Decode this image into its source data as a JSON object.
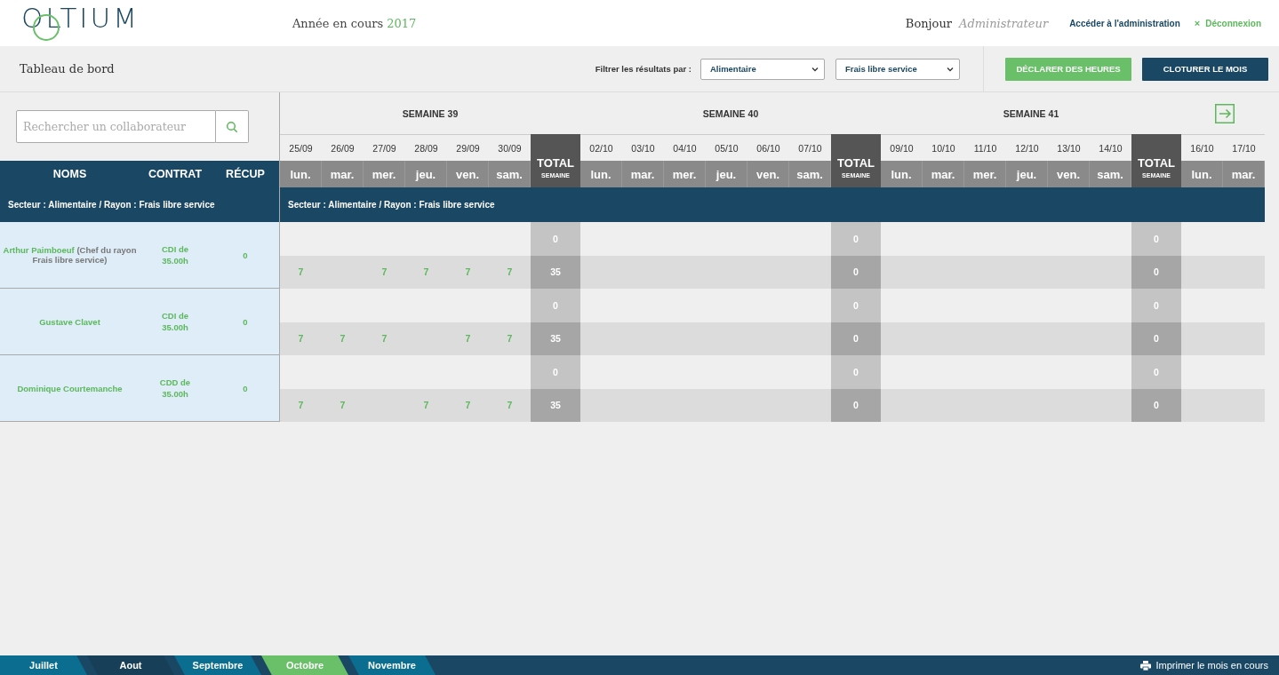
{
  "header": {
    "logo": "OLTIUM",
    "year_label": "Année en cours",
    "year": "2017",
    "greeting": "Bonjour",
    "user": "Administrateur",
    "admin_link": "Accéder à l'administration",
    "logout_icon": "×",
    "logout": "Déconnexion"
  },
  "toolbar": {
    "title": "Tableau de bord",
    "filter_label": "Filtrer les résultats par :",
    "filters": [
      {
        "value": "Alimentaire"
      },
      {
        "value": "Frais libre service"
      }
    ],
    "buttons": [
      {
        "label": "DÉCLARER DES HEURES",
        "kind": "primary"
      },
      {
        "label": "CLOTURER LE MOIS",
        "kind": "dark"
      }
    ]
  },
  "search": {
    "placeholder": "Rechercher un collaborateur"
  },
  "columns": [
    "NOMS",
    "CONTRAT",
    "RÉCUP"
  ],
  "sector": "Secteur : Alimentaire / Rayon : Frais libre service",
  "grid": {
    "sector": "Secteur : Alimentaire / Rayon : Frais libre service",
    "weeks": [
      {
        "title": "SEMAINE 39",
        "days": [
          {
            "date": "25/09",
            "day": "lun."
          },
          {
            "date": "26/09",
            "day": "mar."
          },
          {
            "date": "27/09",
            "day": "mer."
          },
          {
            "date": "28/09",
            "day": "jeu."
          },
          {
            "date": "29/09",
            "day": "ven."
          },
          {
            "date": "30/09",
            "day": "sam."
          }
        ],
        "total": {
          "title": "TOTAL",
          "subtitle": "SEMAINE"
        }
      },
      {
        "title": "SEMAINE 40",
        "days": [
          {
            "date": "02/10",
            "day": "lun."
          },
          {
            "date": "03/10",
            "day": "mar."
          },
          {
            "date": "04/10",
            "day": "mer."
          },
          {
            "date": "05/10",
            "day": "jeu."
          },
          {
            "date": "06/10",
            "day": "ven."
          },
          {
            "date": "07/10",
            "day": "sam."
          }
        ],
        "total": {
          "title": "TOTAL",
          "subtitle": "SEMAINE"
        }
      },
      {
        "title": "SEMAINE 41",
        "days": [
          {
            "date": "09/10",
            "day": "lun."
          },
          {
            "date": "10/10",
            "day": "mar."
          },
          {
            "date": "11/10",
            "day": "mer."
          },
          {
            "date": "12/10",
            "day": "jeu."
          },
          {
            "date": "13/10",
            "day": "ven."
          },
          {
            "date": "14/10",
            "day": "sam."
          }
        ],
        "total": {
          "title": "TOTAL",
          "subtitle": "SEMAINE"
        }
      },
      {
        "next_button": true,
        "days": [
          {
            "date": "16/10",
            "day": "lun."
          },
          {
            "date": "17/10",
            "day": "mar."
          }
        ]
      }
    ]
  },
  "employees": [
    {
      "name": "Arthur Paimboeuf",
      "role": "(Chef du rayon Frais libre service)",
      "contract": "CDI de 35.00h",
      "recup": "0",
      "lines": [
        {
          "weeks": [
            {
              "total": "0"
            },
            {
              "total": "0"
            },
            {
              "total": "0"
            }
          ]
        },
        {
          "weeks": [
            {
              "days": [
                {
                  "kind": "hours",
                  "hours": "7"
                },
                {
                  "kind": "empty"
                },
                {
                  "kind": "hours",
                  "hours": "7"
                },
                {
                  "kind": "hours",
                  "hours": "7"
                },
                {
                  "kind": "hours",
                  "hours": "7"
                },
                {
                  "kind": "hours",
                  "hours": "7"
                }
              ],
              "total": "35"
            },
            {
              "total": "0"
            },
            {
              "total": "0"
            }
          ]
        }
      ]
    },
    {
      "name": "Gustave Clavet",
      "contract": "CDI de 35.00h",
      "recup": "0",
      "lines": [
        {
          "weeks": [
            {
              "total": "0"
            },
            {
              "total": "0"
            },
            {
              "total": "0"
            }
          ]
        },
        {
          "weeks": [
            {
              "days": [
                {
                  "kind": "hours",
                  "hours": "7"
                },
                {
                  "kind": "hours",
                  "hours": "7"
                },
                {
                  "kind": "hours",
                  "hours": "7"
                },
                {
                  "kind": "empty"
                },
                {
                  "kind": "hours",
                  "hours": "7"
                },
                {
                  "kind": "hours",
                  "hours": "7"
                }
              ],
              "total": "35"
            },
            {
              "total": "0"
            },
            {
              "total": "0"
            }
          ]
        }
      ]
    },
    {
      "name": "Dominique Courtemanche",
      "contract": "CDD de 35.00h",
      "recup": "0",
      "lines": [
        {
          "weeks": [
            {
              "total": "0"
            },
            {
              "total": "0"
            },
            {
              "total": "0"
            }
          ]
        },
        {
          "weeks": [
            {
              "days": [
                {
                  "kind": "hours",
                  "hours": "7"
                },
                {
                  "kind": "hours",
                  "hours": "7"
                },
                {
                  "kind": "empty"
                },
                {
                  "kind": "hours",
                  "hours": "7"
                },
                {
                  "kind": "hours",
                  "hours": "7"
                },
                {
                  "kind": "hours",
                  "hours": "7"
                }
              ],
              "total": "35"
            },
            {
              "total": "0"
            },
            {
              "total": "0"
            }
          ]
        }
      ]
    }
  ],
  "months": [
    {
      "label": "Juillet",
      "selected": false,
      "color": "#0b6d8f"
    },
    {
      "label": "Aout",
      "selected": false,
      "color": "#173f58"
    },
    {
      "label": "Septembre",
      "selected": false,
      "color": "#0b6d8f"
    },
    {
      "label": "Octobre",
      "selected": true
    },
    {
      "label": "Novembre",
      "selected": false,
      "color": "#0b6d8f"
    }
  ],
  "print_link": "Imprimer le mois en cours"
}
